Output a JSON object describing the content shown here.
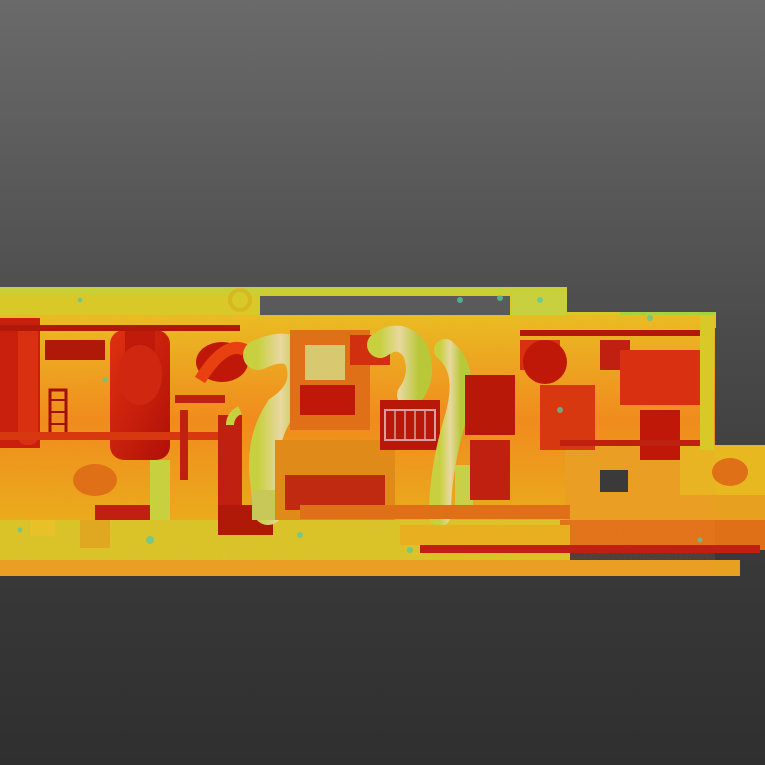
{
  "scene": {
    "kind": "point-cloud-intensity-view",
    "background": {
      "top": "#6a6a6a",
      "bottom": "#2f2f2f"
    },
    "palette": {
      "low": "#c0180c",
      "mid_low": "#e04a12",
      "mid": "#f08a1a",
      "mid_high": "#e8c020",
      "high": "#b8d830",
      "peak": "#58c8a0"
    }
  }
}
